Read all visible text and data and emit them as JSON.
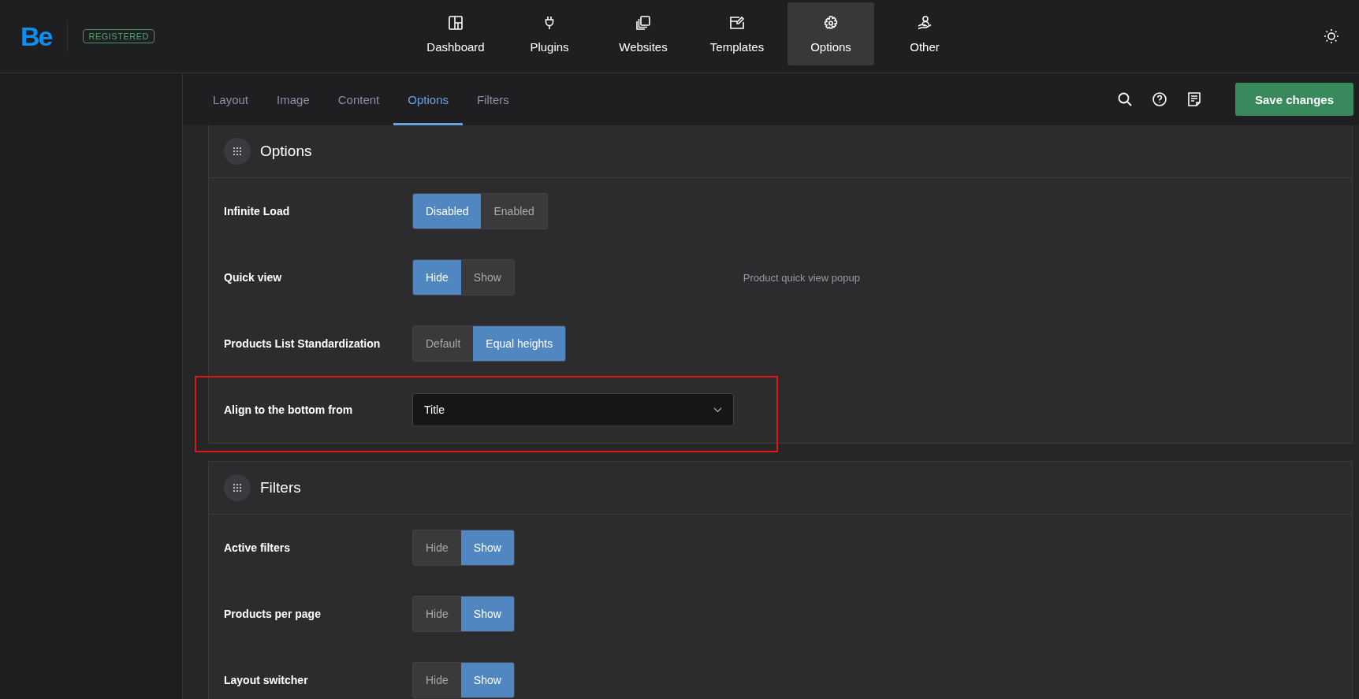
{
  "brand": {
    "logo": "Be",
    "badge": "REGISTERED"
  },
  "nav": [
    {
      "label": "Dashboard",
      "selected": false
    },
    {
      "label": "Plugins",
      "selected": false
    },
    {
      "label": "Websites",
      "selected": false
    },
    {
      "label": "Templates",
      "selected": false
    },
    {
      "label": "Options",
      "selected": true
    },
    {
      "label": "Other",
      "selected": false
    }
  ],
  "tabs": [
    {
      "label": "Layout",
      "selected": false
    },
    {
      "label": "Image",
      "selected": false
    },
    {
      "label": "Content",
      "selected": false
    },
    {
      "label": "Options",
      "selected": true
    },
    {
      "label": "Filters",
      "selected": false
    }
  ],
  "save_button": "Save changes",
  "sections": [
    {
      "title": "Options",
      "rows": [
        {
          "kind": "toggle",
          "label": "Infinite Load",
          "options": [
            {
              "label": "Disabled",
              "selected": true
            },
            {
              "label": "Enabled",
              "selected": false
            }
          ]
        },
        {
          "kind": "toggle",
          "label": "Quick view",
          "note": "Product quick view popup",
          "options": [
            {
              "label": "Hide",
              "selected": true
            },
            {
              "label": "Show",
              "selected": false
            }
          ]
        },
        {
          "kind": "toggle",
          "label": "Products List Standardization",
          "options": [
            {
              "label": "Default",
              "selected": false
            },
            {
              "label": "Equal heights",
              "selected": true
            }
          ]
        },
        {
          "kind": "select",
          "label": "Align to the bottom from",
          "highlighted": true,
          "value": "Title"
        }
      ]
    },
    {
      "title": "Filters",
      "rows": [
        {
          "kind": "toggle",
          "label": "Active filters",
          "options": [
            {
              "label": "Hide",
              "selected": false
            },
            {
              "label": "Show",
              "selected": true
            }
          ]
        },
        {
          "kind": "toggle",
          "label": "Products per page",
          "options": [
            {
              "label": "Hide",
              "selected": false
            },
            {
              "label": "Show",
              "selected": true
            }
          ]
        },
        {
          "kind": "toggle",
          "label": "Layout switcher",
          "options": [
            {
              "label": "Hide",
              "selected": false
            },
            {
              "label": "Show",
              "selected": true
            }
          ]
        }
      ]
    }
  ]
}
